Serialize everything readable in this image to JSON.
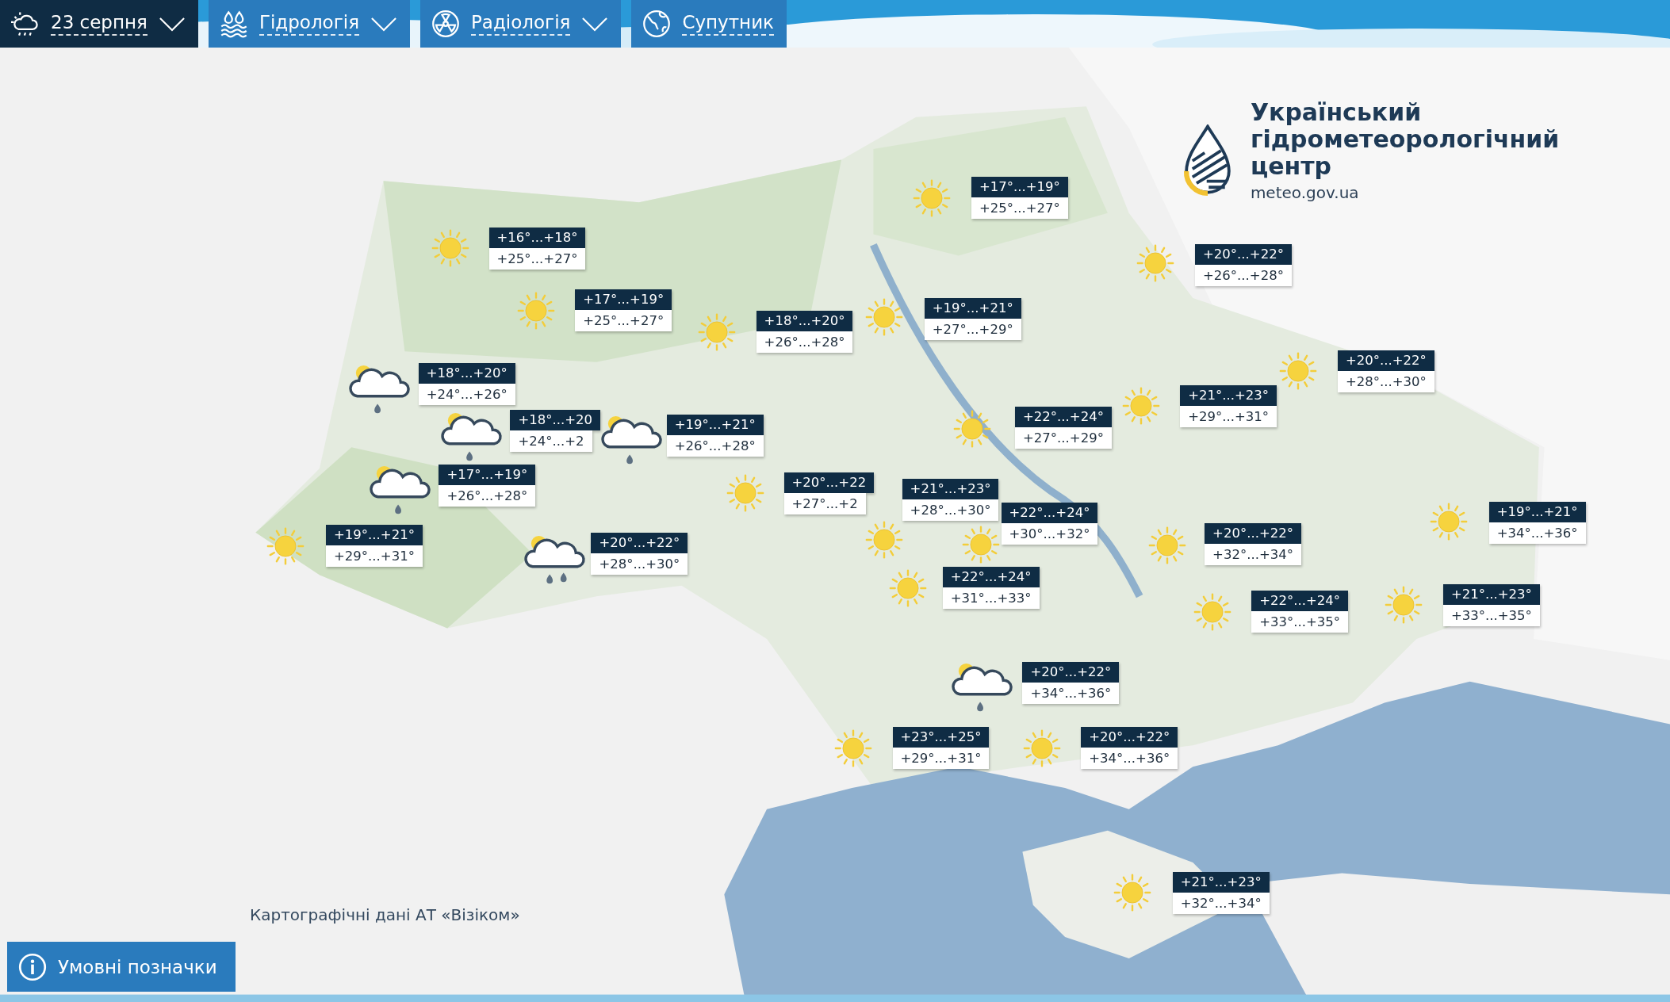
{
  "tabs": [
    {
      "label": "23 серпня",
      "selected": true,
      "dropdown": true
    },
    {
      "label": "Гідрологія",
      "selected": false,
      "dropdown": true
    },
    {
      "label": "Радіологія",
      "selected": false,
      "dropdown": true
    },
    {
      "label": "Супутник",
      "selected": false,
      "dropdown": false
    }
  ],
  "logo": {
    "title": "Український гідрометеорологічний центр",
    "site": "meteo.gov.ua"
  },
  "forecasts": [
    {
      "kind": "sun",
      "night": "+16°...+18°",
      "day": "+25°...+27°"
    },
    {
      "kind": "sun",
      "night": "+17°...+19°",
      "day": "+25°...+27°"
    },
    {
      "kind": "sun",
      "night": "+18°...+20°",
      "day": "+26°...+28°"
    },
    {
      "kind": "sun",
      "night": "+17°...+19°",
      "day": "+25°...+27°"
    },
    {
      "kind": "sun",
      "night": "+19°...+21°",
      "day": "+27°...+29°"
    },
    {
      "kind": "sun",
      "night": "+20°...+22°",
      "day": "+26°...+28°"
    },
    {
      "kind": "sun",
      "night": "+20°...+22°",
      "day": "+28°...+30°"
    },
    {
      "kind": "sun",
      "night": "+21°...+23°",
      "day": "+29°...+31°"
    },
    {
      "kind": "sun",
      "night": "+22°...+24°",
      "day": "+27°...+29°"
    },
    {
      "kind": "rain",
      "night": "+18°...+20°",
      "day": "+24°...+26°"
    },
    {
      "kind": "rain",
      "night": "+18°...+20",
      "day": "+24°...+2"
    },
    {
      "kind": "rain",
      "night": "+19°...+21°",
      "day": "+26°...+28°"
    },
    {
      "kind": "rain",
      "night": "+17°...+19°",
      "day": "+26°...+28°"
    },
    {
      "kind": "sun",
      "night": "+19°...+21°",
      "day": "+29°...+31°"
    },
    {
      "kind": "showers",
      "night": "+20°...+22°",
      "day": "+28°...+30°"
    },
    {
      "kind": "sun",
      "night": "+20°...+22",
      "day": "+27°...+2"
    },
    {
      "kind": "sun",
      "night": "+21°...+23°",
      "day": "+28°...+30°"
    },
    {
      "kind": "sun",
      "night": "+22°...+24°",
      "day": "+30°...+32°"
    },
    {
      "kind": "sun",
      "night": "+22°...+24°",
      "day": "+31°...+33°"
    },
    {
      "kind": "sun",
      "night": "+20°...+22°",
      "day": "+32°...+34°"
    },
    {
      "kind": "sun",
      "night": "+19°...+21°",
      "day": "+34°...+36°"
    },
    {
      "kind": "sun",
      "night": "+22°...+24°",
      "day": "+33°...+35°"
    },
    {
      "kind": "sun",
      "night": "+21°...+23°",
      "day": "+33°...+35°"
    },
    {
      "kind": "rain",
      "night": "+20°...+22°",
      "day": "+34°...+36°"
    },
    {
      "kind": "sun",
      "night": "+23°...+25°",
      "day": "+29°...+31°"
    },
    {
      "kind": "sun",
      "night": "+20°...+22°",
      "day": "+34°...+36°"
    },
    {
      "kind": "sun",
      "night": "+21°...+23°",
      "day": "+32°...+34°"
    }
  ],
  "attribution": "Картографічні дані АТ «Візіком»",
  "legend_button": {
    "label": "Умовні позначки"
  }
}
